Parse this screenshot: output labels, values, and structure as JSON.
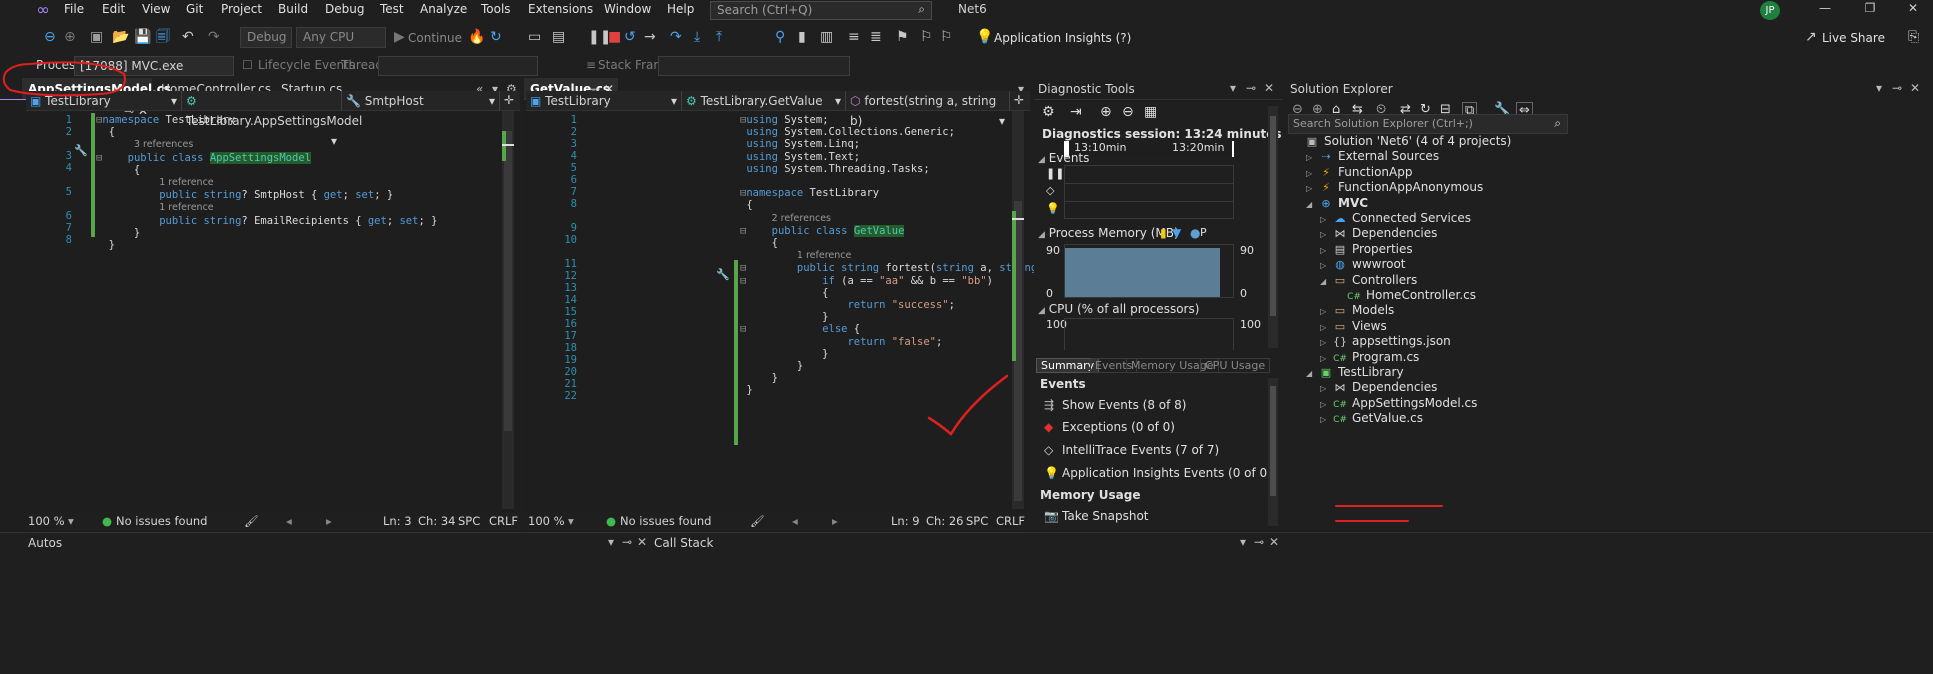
{
  "menubar": {
    "items": [
      "File",
      "Edit",
      "View",
      "Git",
      "Project",
      "Build",
      "Debug",
      "Test",
      "Analyze",
      "Tools",
      "Extensions",
      "Window",
      "Help"
    ],
    "search_placeholder": "Search (Ctrl+Q)",
    "solution_name": "Net6",
    "avatar_initials": "JP"
  },
  "toolbar": {
    "config": "Debug",
    "platform": "Any CPU",
    "continue_label": "Continue",
    "app_insights": "Application Insights (?)",
    "live_share": "Live Share"
  },
  "processbar": {
    "process_label": "Process:",
    "process_value": "[17088] MVC.exe",
    "lifecycle_label": "Lifecycle Events",
    "thread_label": "Thread:",
    "stack_frame_label": "Stack Frame:"
  },
  "editor1": {
    "tabs": [
      {
        "label": "AppSettingsModel.cs",
        "active": true
      },
      {
        "label": "HomeController.cs",
        "active": false
      },
      {
        "label": "Startup.cs",
        "active": false
      }
    ],
    "nav": [
      "TestLibrary",
      "TestLibrary.AppSettingsModel",
      "SmtpHost"
    ],
    "line_numbers": [
      "1",
      "2",
      "",
      "3",
      "4",
      "",
      "5",
      "",
      "6",
      "7",
      "8"
    ],
    "zoom": "100 %",
    "issues": "No issues found",
    "ln": "Ln: 3",
    "ch": "Ch: 34",
    "spc": "SPC",
    "crlf": "CRLF"
  },
  "editor2": {
    "tabs": [
      {
        "label": "GetValue.cs",
        "active": true
      }
    ],
    "nav": [
      "TestLibrary",
      "TestLibrary.GetValue",
      "fortest(string a, string b)"
    ],
    "line_numbers": [
      "1",
      "2",
      "3",
      "4",
      "5",
      "6",
      "7",
      "8",
      "",
      "9",
      "10",
      "",
      "11",
      "12",
      "13",
      "14",
      "15",
      "16",
      "17",
      "18",
      "19",
      "20",
      "21",
      "22"
    ],
    "zoom": "100 %",
    "issues": "No issues found",
    "ln": "Ln: 9",
    "ch": "Ch: 26",
    "spc": "SPC",
    "crlf": "CRLF"
  },
  "diagnostic": {
    "title": "Diagnostic Tools",
    "session": "Diagnostics session: 13:24 minutes",
    "time1": "13:10min",
    "time2": "13:20min",
    "events": "Events",
    "process_memory": "Process Memory (MB)",
    "mem_legend_p": "P",
    "mem_max_left": "90",
    "mem_max_right": "90",
    "mem_min_left": "0",
    "mem_min_right": "0",
    "memory_level_pct": 95,
    "cpu": "CPU (% of all processors)",
    "cpu_max_left": "100",
    "cpu_max_right": "100",
    "tabs": [
      "Summary",
      "Events",
      "Memory Usage",
      "CPU Usage"
    ],
    "events_header": "Events",
    "event_items": [
      "Show Events (8 of 8)",
      "Exceptions (0 of 0)",
      "IntelliTrace Events (7 of 7)",
      "Application Insights Events (0 of 0)"
    ],
    "memory_usage_header": "Memory Usage",
    "take_snapshot": "Take Snapshot"
  },
  "solution_explorer": {
    "title": "Solution Explorer",
    "search_placeholder": "Search Solution Explorer (Ctrl+;)",
    "items": [
      {
        "label": "Solution 'Net6' (4 of 4 projects)",
        "indent": 0,
        "icon": "solution-icon"
      },
      {
        "label": "External Sources",
        "indent": 1,
        "icon": "external-sources-icon"
      },
      {
        "label": "FunctionApp",
        "indent": 1,
        "icon": "function-app-icon"
      },
      {
        "label": "FunctionAppAnonymous",
        "indent": 1,
        "icon": "function-app-icon"
      },
      {
        "label": "MVC",
        "indent": 1,
        "icon": "web-project-icon"
      },
      {
        "label": "Connected Services",
        "indent": 2,
        "icon": "connected-services-icon"
      },
      {
        "label": "Dependencies",
        "indent": 2,
        "icon": "dependencies-icon"
      },
      {
        "label": "Properties",
        "indent": 2,
        "icon": "properties-icon"
      },
      {
        "label": "wwwroot",
        "indent": 2,
        "icon": "globe-icon"
      },
      {
        "label": "Controllers",
        "indent": 2,
        "icon": "folder-icon"
      },
      {
        "label": "HomeController.cs",
        "indent": 3,
        "icon": "csharp-file-icon"
      },
      {
        "label": "Models",
        "indent": 2,
        "icon": "folder-icon"
      },
      {
        "label": "Views",
        "indent": 2,
        "icon": "folder-icon"
      },
      {
        "label": "appsettings.json",
        "indent": 2,
        "icon": "json-file-icon"
      },
      {
        "label": "Program.cs",
        "indent": 2,
        "icon": "csharp-file-icon"
      },
      {
        "label": "TestLibrary",
        "indent": 1,
        "icon": "library-project-icon"
      },
      {
        "label": "Dependencies",
        "indent": 2,
        "icon": "dependencies-icon"
      },
      {
        "label": "AppSettingsModel.cs",
        "indent": 2,
        "icon": "csharp-file-icon"
      },
      {
        "label": "GetValue.cs",
        "indent": 2,
        "icon": "csharp-file-icon"
      }
    ]
  },
  "bottom": {
    "autos": "Autos",
    "call_stack": "Call Stack"
  },
  "colors": {
    "accent": "#a887f3",
    "annotation": "#e02020",
    "change_bar": "#57a64a"
  }
}
